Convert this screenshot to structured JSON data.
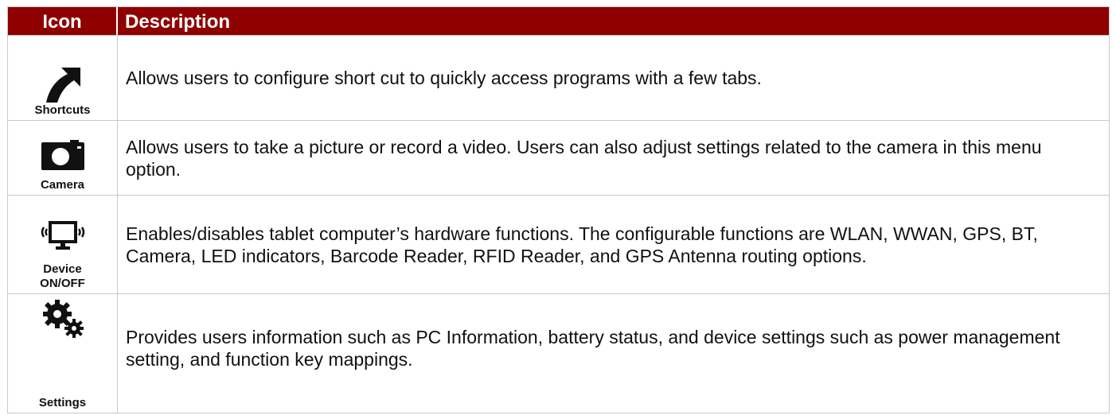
{
  "table": {
    "header": {
      "icon": "Icon",
      "description": "Description"
    },
    "rows": [
      {
        "icon_name": "shortcut-arrow-icon",
        "label": "Shortcuts",
        "description": "Allows users to configure short cut to quickly access programs with a few tabs."
      },
      {
        "icon_name": "camera-icon",
        "label": "Camera",
        "description": "Allows users to take a picture or record a video. Users can also adjust settings related to the camera in this menu option."
      },
      {
        "icon_name": "monitor-signal-icon",
        "label_line1": "Device",
        "label_line2": "ON/OFF",
        "description": "Enables/disables tablet computer’s hardware functions. The configurable functions are WLAN, WWAN, GPS, BT, Camera, LED indicators, Barcode Reader, RFID Reader, and GPS Antenna routing options."
      },
      {
        "icon_name": "gears-icon",
        "label": "Settings",
        "description": "Provides users information such as PC Information, battery status, and device settings such as power management setting, and function key mappings."
      }
    ],
    "colors": {
      "header_bg": "#8f0000",
      "header_text": "#ffffff",
      "border": "#c9c9c9",
      "icon_fill": "#111111"
    }
  }
}
